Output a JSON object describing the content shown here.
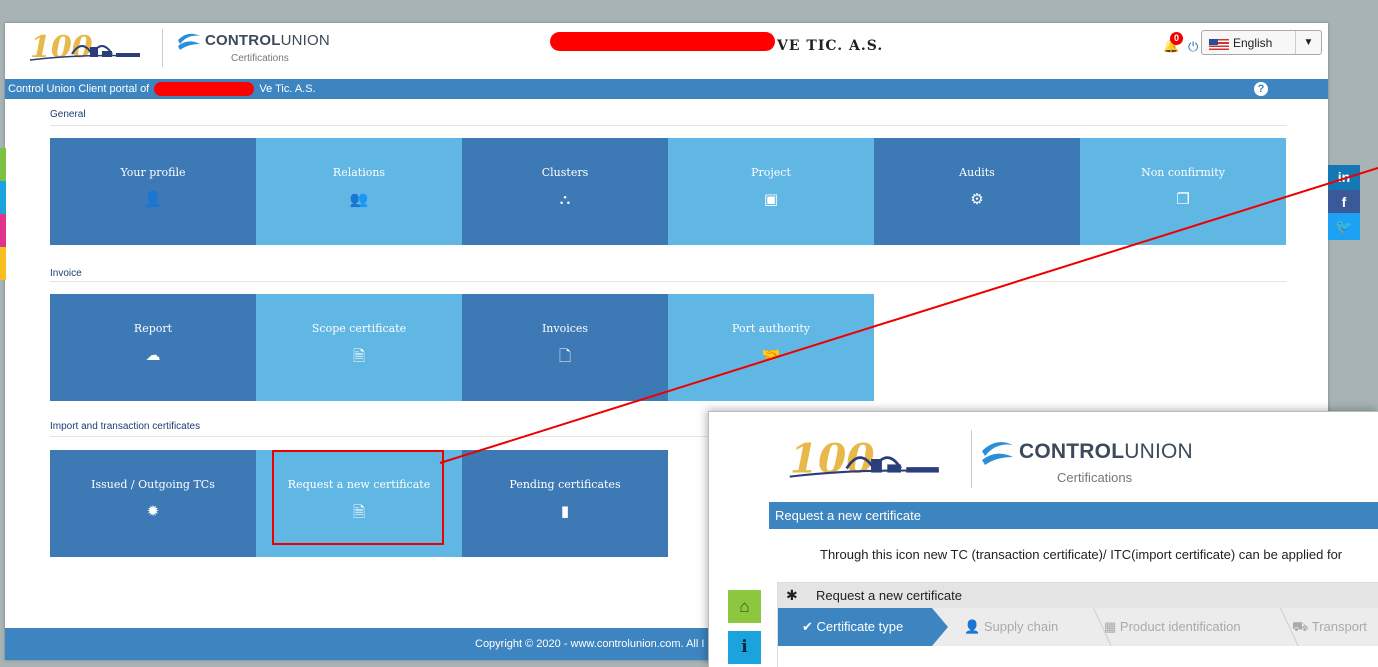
{
  "header": {
    "brand_bold": "CONTROL",
    "brand_light": "UNION",
    "brand_sub": "Certifications",
    "company_suffix": "VE TIC. A.S.",
    "notification_count": "0",
    "language": "English"
  },
  "portal_bar": {
    "prefix": "Control Union Client portal of",
    "suffix": "Ve Tic. A.S."
  },
  "sections": {
    "general": {
      "title": "General",
      "tiles": [
        {
          "label": "Your profile",
          "icon": "user-icon"
        },
        {
          "label": "Relations",
          "icon": "users-icon"
        },
        {
          "label": "Clusters",
          "icon": "sitemap-icon"
        },
        {
          "label": "Project",
          "icon": "image-file-icon"
        },
        {
          "label": "Audits",
          "icon": "gears-icon"
        },
        {
          "label": "Non confirmity",
          "icon": "copy-icon"
        }
      ]
    },
    "invoice": {
      "title": "Invoice",
      "tiles": [
        {
          "label": "Report",
          "icon": "cloud-chart-icon"
        },
        {
          "label": "Scope certificate",
          "icon": "document-icon"
        },
        {
          "label": "Invoices",
          "icon": "pdf-icon"
        },
        {
          "label": "Port authority",
          "icon": "handshake-icon"
        }
      ]
    },
    "certificates": {
      "title": "Import and transaction certificates",
      "tiles": [
        {
          "label": "Issued / Outgoing TCs",
          "icon": "certificate-icon"
        },
        {
          "label": "Request a new certificate",
          "icon": "document-icon"
        },
        {
          "label": "Pending certificates",
          "icon": "file-icon"
        }
      ]
    }
  },
  "footer": {
    "text": "Copyright © 2020 - www.controlunion.com. All I"
  },
  "social": [
    "in",
    "f"
  ],
  "popup": {
    "bar_title": "Request a new certificate",
    "description": "Through this icon new TC (transaction certificate)/ ITC(import certificate) can be applied for",
    "panel_title": "Request a new certificate",
    "steps": [
      "Certificate type",
      "Supply chain",
      "Product identification",
      "Transport"
    ]
  },
  "colors": {
    "dark_tile": "#3d79b4",
    "light_tile": "#61b7e3",
    "bar": "#3d85c1",
    "highlight": "#e00000"
  }
}
